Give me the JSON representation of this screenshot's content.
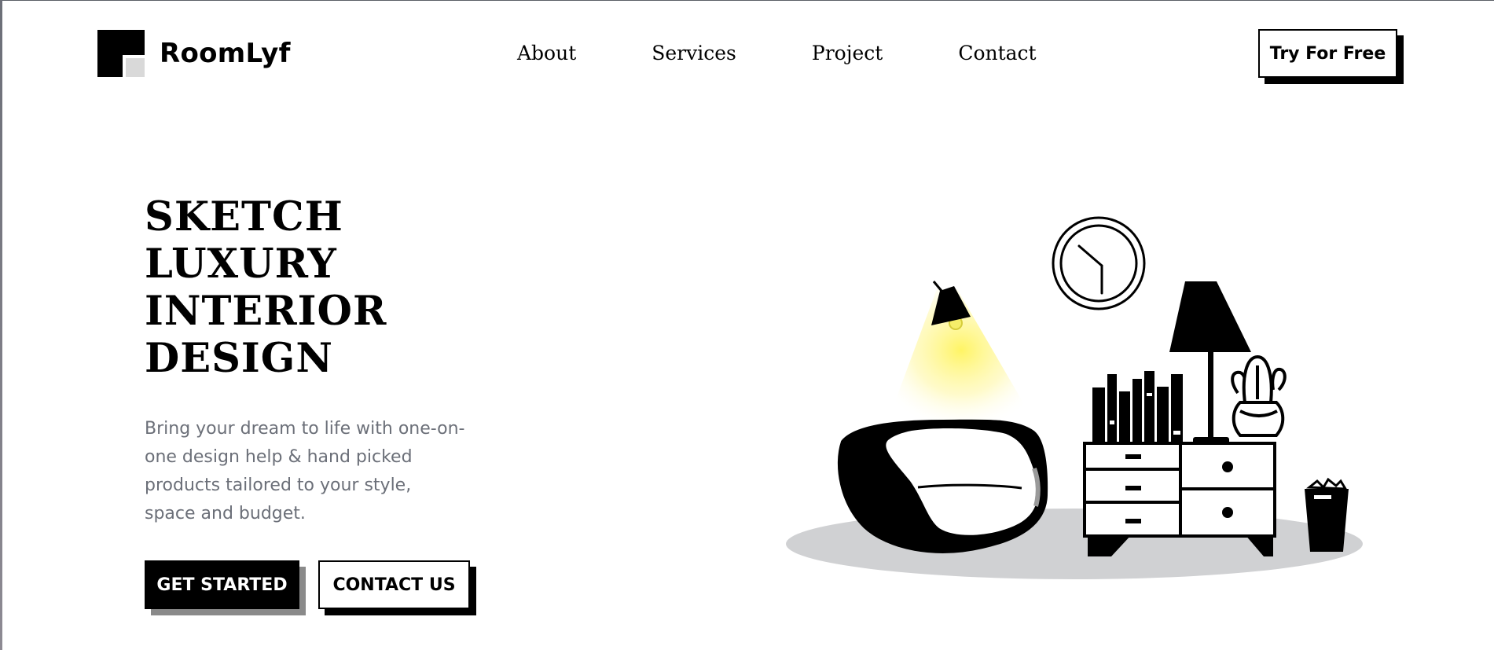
{
  "brand": {
    "name": "RoomLyf"
  },
  "nav": {
    "items": [
      {
        "label": "About"
      },
      {
        "label": "Services"
      },
      {
        "label": "Project"
      },
      {
        "label": "Contact"
      }
    ]
  },
  "header": {
    "cta_label": "Try For Free"
  },
  "hero": {
    "title_lines": [
      "SKETCH",
      "LUXURY",
      "INTERIOR",
      "DESIGN"
    ],
    "description": "Bring your dream to life with one-on-one design help & hand picked products tailored to your style, space and budget.",
    "primary_button": "GET STARTED",
    "secondary_button": "CONTACT US"
  },
  "colors": {
    "accent_light": "#fff45c",
    "shadow_gray": "#8a8a8a",
    "floor_gray": "#d0d1d3",
    "text_muted": "#6b6f78"
  },
  "illustration": {
    "icons": [
      "clock-icon",
      "wall-lamp-icon",
      "armchair-icon",
      "bookshelf-books-icon",
      "table-lamp-icon",
      "cactus-plant-icon",
      "dresser-icon",
      "waste-basket-icon"
    ]
  }
}
